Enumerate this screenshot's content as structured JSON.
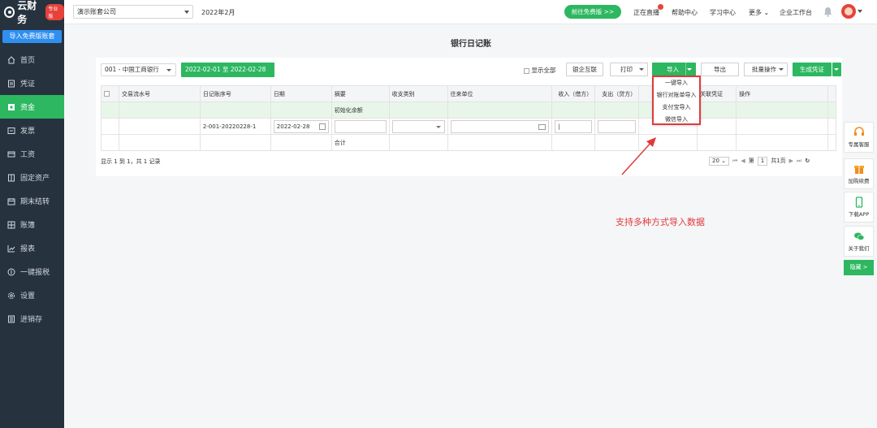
{
  "sidebar": {
    "brand": "云财务",
    "brand_badge": "专业版",
    "import_button": "导入免费版账套",
    "items": [
      {
        "label": "首页",
        "icon": "home-icon"
      },
      {
        "label": "凭证",
        "icon": "voucher-icon"
      },
      {
        "label": "资金",
        "icon": "fund-icon",
        "active": true
      },
      {
        "label": "发票",
        "icon": "invoice-icon"
      },
      {
        "label": "工资",
        "icon": "salary-icon"
      },
      {
        "label": "固定资产",
        "icon": "asset-icon"
      },
      {
        "label": "期末结转",
        "icon": "period-close-icon"
      },
      {
        "label": "账簿",
        "icon": "ledger-icon"
      },
      {
        "label": "报表",
        "icon": "report-icon"
      },
      {
        "label": "一键报税",
        "icon": "tax-icon"
      },
      {
        "label": "设置",
        "icon": "settings-icon"
      },
      {
        "label": "进销存",
        "icon": "inventory-icon"
      }
    ]
  },
  "header": {
    "company": "演示账套公司",
    "period": "2022年2月",
    "free_button": "前往免费版 >>",
    "links": [
      "正在直播",
      "帮助中心",
      "学习中心",
      "更多",
      "企业工作台"
    ]
  },
  "page": {
    "title": "银行日记账",
    "bank": "001 - 中国工商银行",
    "date_range": "2022-02-01 至 2022-02-28",
    "show_all": "显示全部",
    "buttons": {
      "bank_link": "银企互联",
      "print": "打印",
      "import": "导入",
      "export": "导出",
      "batch": "批量操作",
      "generate": "生成凭证"
    }
  },
  "table": {
    "headers": [
      "交易流水号",
      "日记账序号",
      "日期",
      "摘要",
      "收支类别",
      "往来单位",
      "收入（借方）",
      "支出（贷方）",
      "",
      "关联凭证",
      "操作"
    ],
    "init_row_summary": "初始化余额",
    "row1": {
      "seq": "2-001-20220228-1",
      "date": "2022-02-28"
    },
    "total_label": "合计"
  },
  "footer": {
    "info": "显示 1 到 1，共 1 记录",
    "page_size": "20",
    "page_prefix": "第",
    "page_num": "1",
    "page_suffix": "共1页"
  },
  "import_menu": [
    "一键导入",
    "银行对账单导入",
    "支付宝导入",
    "微信导入"
  ],
  "annotation": "支持多种方式导入数据",
  "float_panel": {
    "service": "专属客服",
    "buy": "加购续费",
    "app": "下载APP",
    "about": "关于我们",
    "hide": "隐藏 >"
  },
  "colors": {
    "accent_green": "#2db760",
    "sidebar_bg": "#26323e",
    "annotation_red": "#e03a3a"
  }
}
